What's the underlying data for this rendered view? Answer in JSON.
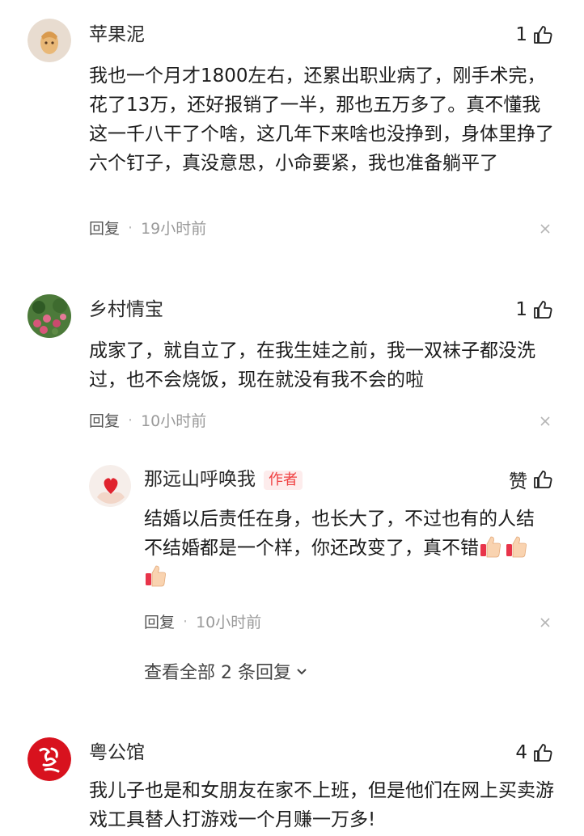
{
  "comments": [
    {
      "username": "苹果泥",
      "likes": "1",
      "text": "我也一个月才1800左右，还累出职业病了，刚手术完，花了13万，还好报销了一半，那也五万多了。真不懂我这一千八干了个啥，这几年下来啥也没挣到，身体里挣了六个钉子，真没意思，小命要紧，我也准备躺平了",
      "reply_label": "回复",
      "dot": "·",
      "time": "19小时前"
    },
    {
      "username": "乡村情宝",
      "likes": "1",
      "text": "成家了，就自立了，在我生娃之前，我一双袜子都没洗过，也不会烧饭，现在就没有我不会的啦",
      "reply_label": "回复",
      "dot": "·",
      "time": "10小时前",
      "replies": [
        {
          "username": "那远山呼唤我",
          "badge": "作者",
          "likes": "赞",
          "text_line1": "结婚以后责任在身，也长大了，不过也有的人结",
          "text_line2": "不结婚都是一个样，你还改变了，真不错",
          "reply_label": "回复",
          "dot": "·",
          "time": "10小时前"
        }
      ],
      "view_all": "查看全部 2 条回复"
    },
    {
      "username": "粤公馆",
      "likes": "4",
      "text": "我儿子也是和女朋友在家不上班，但是他们在网上买卖游戏工具替人打游戏一个月赚一万多!"
    }
  ],
  "colors": {
    "badge_red": "#f04142",
    "meta_gray": "#9a9a9a"
  }
}
